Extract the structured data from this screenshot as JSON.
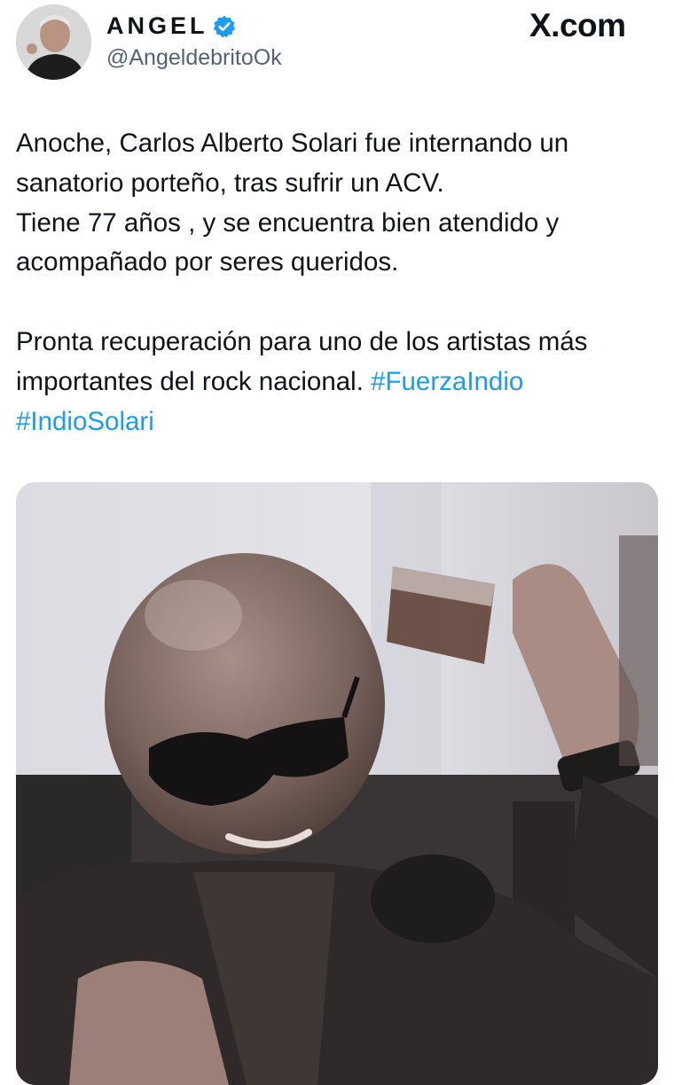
{
  "author": {
    "display_name": "ANGEL",
    "handle": "@AngeldebritoOk",
    "verified": true
  },
  "source_label": "X.com",
  "tweet": {
    "paragraph1": [
      "Anoche, Carlos Alberto Solari fue internando un",
      "sanatorio porteño, tras sufrir un ACV.",
      "Tiene 77 años , y se encuentra bien atendido y",
      "acompañado por seres queridos."
    ],
    "paragraph2_text": [
      "Pronta recuperación para uno de los artistas más",
      "importantes del rock nacional. "
    ],
    "hashtags": [
      "#FuerzaIndio",
      "#IndioSolari"
    ]
  },
  "colors": {
    "hashtag": "#1d9bf0",
    "verified_badge": "#1d9bf0",
    "text": "#0f1419",
    "secondary_text": "#536471"
  },
  "icons": {
    "verified": "verified-badge-icon"
  }
}
